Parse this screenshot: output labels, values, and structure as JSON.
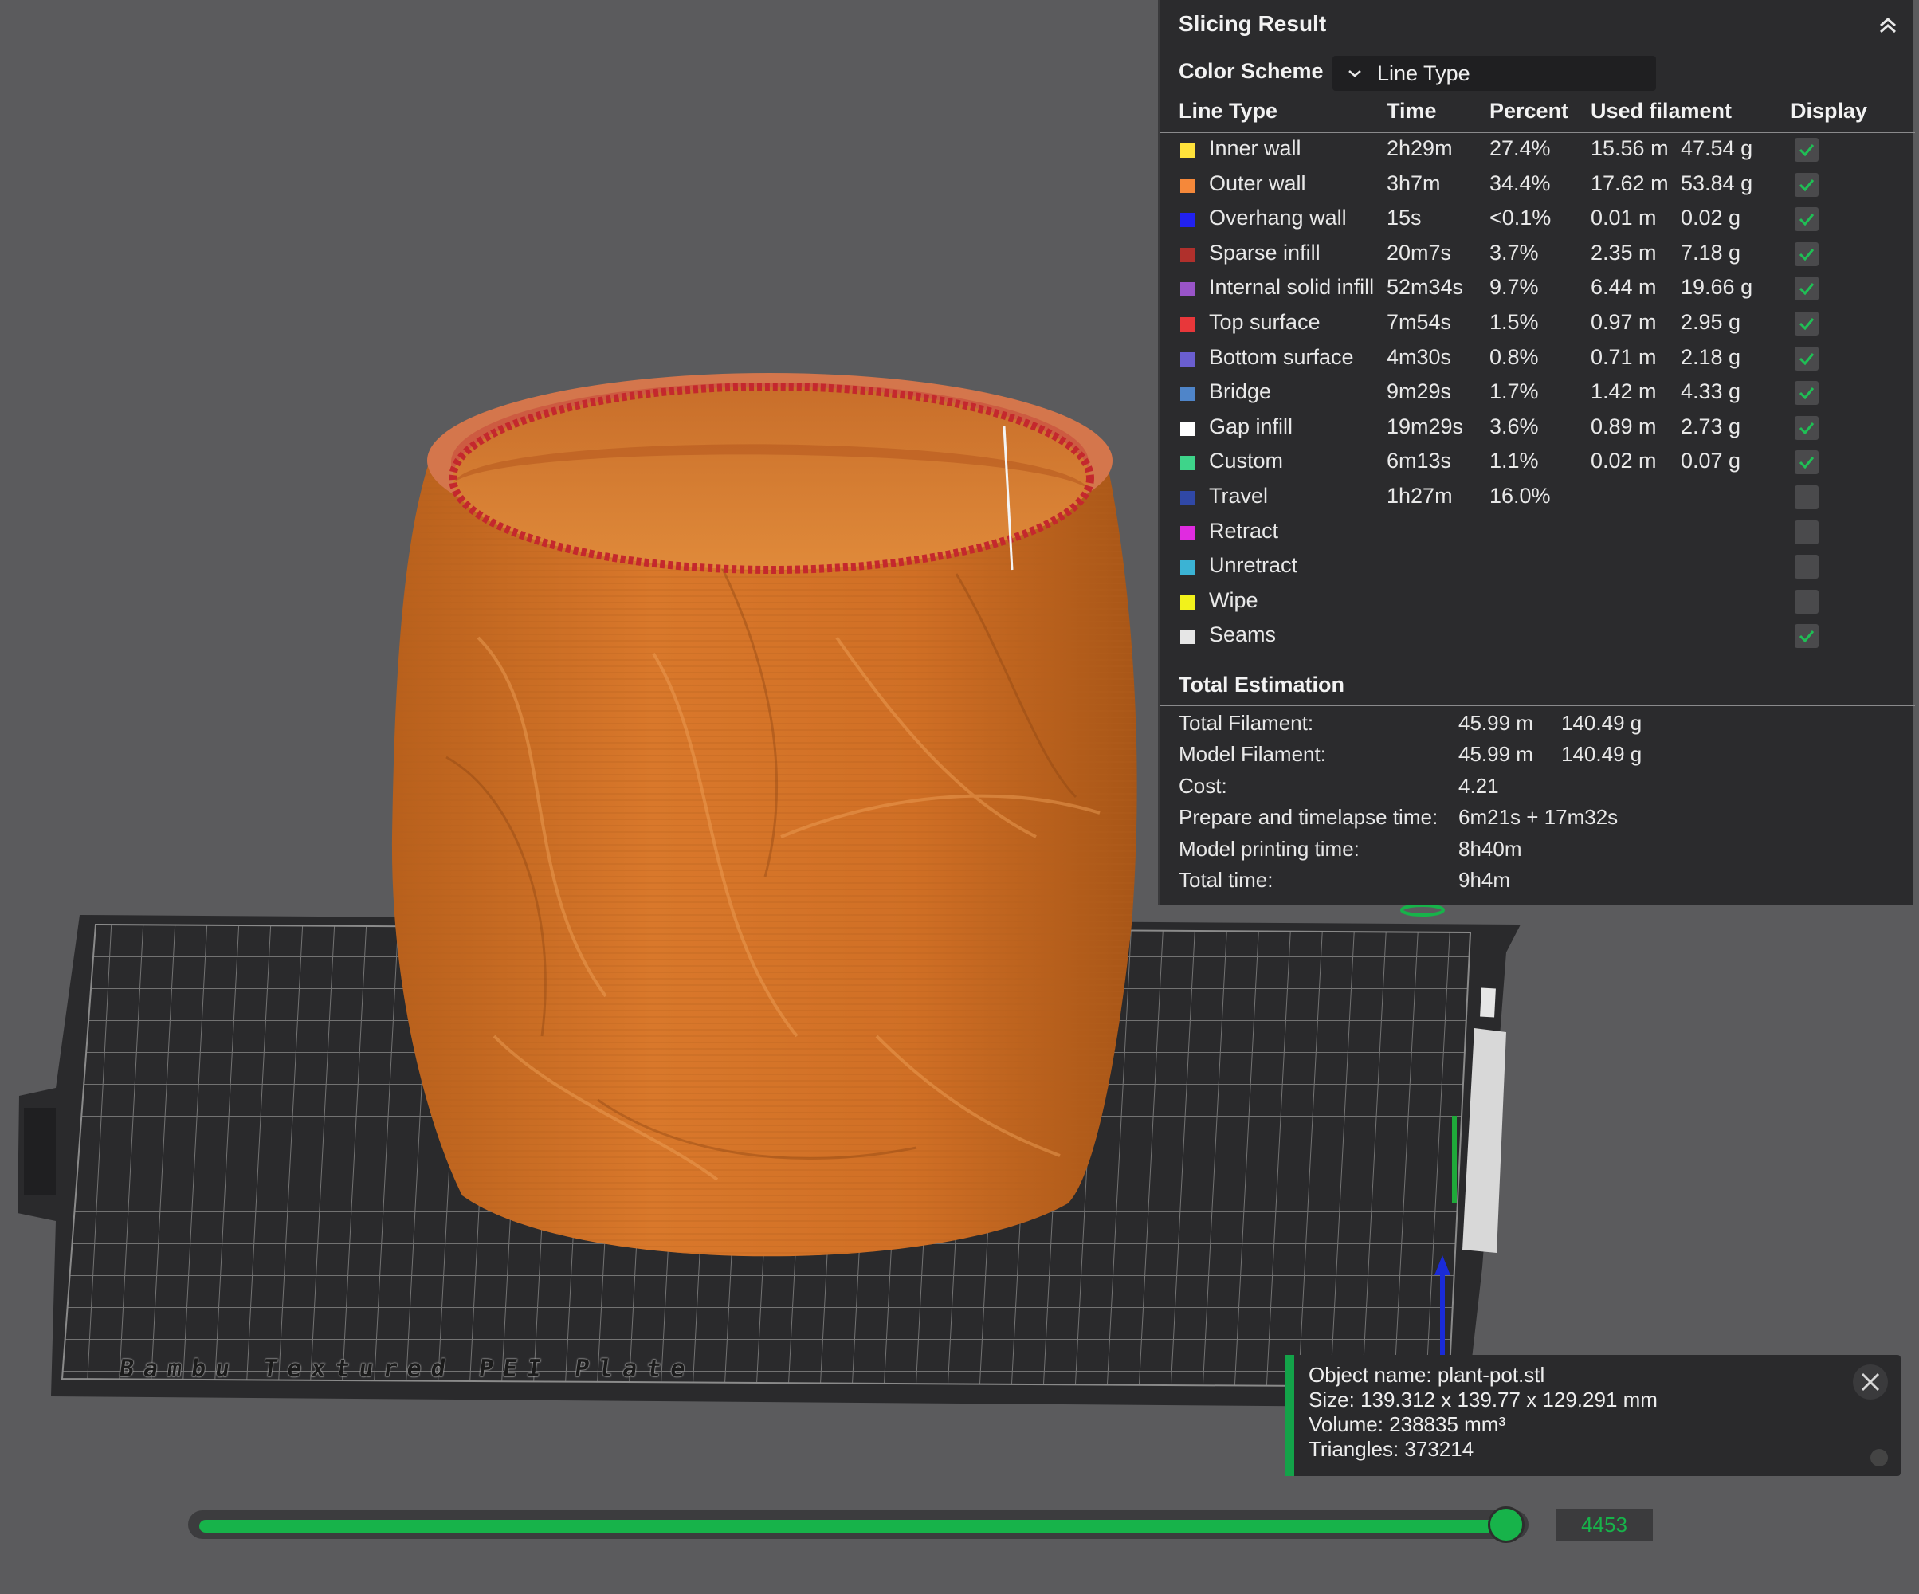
{
  "viewport": {
    "plate_label": "Bambu Textured PEI Plate"
  },
  "slicing_result": {
    "title": "Slicing Result",
    "color_scheme_label": "Color Scheme",
    "color_scheme_value": "Line Type",
    "columns": [
      "Line Type",
      "Time",
      "Percent",
      "Used filament",
      "Display"
    ],
    "rows": [
      {
        "name": "Inner wall",
        "color": "#ffe23b",
        "time": "2h29m",
        "percent": "27.4%",
        "length": "15.56 m",
        "weight": "47.54 g",
        "display": true
      },
      {
        "name": "Outer wall",
        "color": "#f5883a",
        "time": "3h7m",
        "percent": "34.4%",
        "length": "17.62 m",
        "weight": "53.84 g",
        "display": true
      },
      {
        "name": "Overhang wall",
        "color": "#2121f0",
        "time": "15s",
        "percent": "<0.1%",
        "length": "0.01 m",
        "weight": "0.02 g",
        "display": true
      },
      {
        "name": "Sparse infill",
        "color": "#b0302c",
        "time": "20m7s",
        "percent": "3.7%",
        "length": "2.35 m",
        "weight": "7.18 g",
        "display": true
      },
      {
        "name": "Internal solid infill",
        "color": "#9954c8",
        "time": "52m34s",
        "percent": "9.7%",
        "length": "6.44 m",
        "weight": "19.66 g",
        "display": true
      },
      {
        "name": "Top surface",
        "color": "#e8373a",
        "time": "7m54s",
        "percent": "1.5%",
        "length": "0.97 m",
        "weight": "2.95 g",
        "display": true
      },
      {
        "name": "Bottom surface",
        "color": "#6a5ecf",
        "time": "4m30s",
        "percent": "0.8%",
        "length": "0.71 m",
        "weight": "2.18 g",
        "display": true
      },
      {
        "name": "Bridge",
        "color": "#4f85c9",
        "time": "9m29s",
        "percent": "1.7%",
        "length": "1.42 m",
        "weight": "4.33 g",
        "display": true
      },
      {
        "name": "Gap infill",
        "color": "#ffffff",
        "time": "19m29s",
        "percent": "3.6%",
        "length": "0.89 m",
        "weight": "2.73 g",
        "display": true
      },
      {
        "name": "Custom",
        "color": "#3ed48a",
        "time": "6m13s",
        "percent": "1.1%",
        "length": "0.02 m",
        "weight": "0.07 g",
        "display": true
      },
      {
        "name": "Travel",
        "color": "#3048a6",
        "time": "1h27m",
        "percent": "16.0%",
        "length": "",
        "weight": "",
        "display": false
      },
      {
        "name": "Retract",
        "color": "#e02be0",
        "time": "",
        "percent": "",
        "length": "",
        "weight": "",
        "display": false
      },
      {
        "name": "Unretract",
        "color": "#3bb3d4",
        "time": "",
        "percent": "",
        "length": "",
        "weight": "",
        "display": false
      },
      {
        "name": "Wipe",
        "color": "#f2f21b",
        "time": "",
        "percent": "",
        "length": "",
        "weight": "",
        "display": false
      },
      {
        "name": "Seams",
        "color": "#e6e6e6",
        "time": "",
        "percent": "",
        "length": "",
        "weight": "",
        "display": true
      }
    ],
    "total_title": "Total Estimation",
    "totals": [
      {
        "label": "Total Filament:",
        "v1": "45.99 m",
        "v2": "140.49 g"
      },
      {
        "label": "Model Filament:",
        "v1": "45.99 m",
        "v2": "140.49 g"
      },
      {
        "label": "Cost:",
        "v1": "4.21",
        "v2": ""
      },
      {
        "label": "Prepare and timelapse time:",
        "v1": "6m21s + 17m32s",
        "v2": ""
      },
      {
        "label": "Model printing time:",
        "v1": "8h40m",
        "v2": ""
      },
      {
        "label": "Total time:",
        "v1": "9h4m",
        "v2": ""
      }
    ]
  },
  "object_info": {
    "name_line": "Object name: plant-pot.stl",
    "size_line": "Size: 139.312 x 139.77 x 129.291 mm",
    "volume_line": "Volume: 238835 mm³",
    "triangles_line": "Triangles: 373214"
  },
  "layer_slider": {
    "value": "4453",
    "position": 1.0
  }
}
